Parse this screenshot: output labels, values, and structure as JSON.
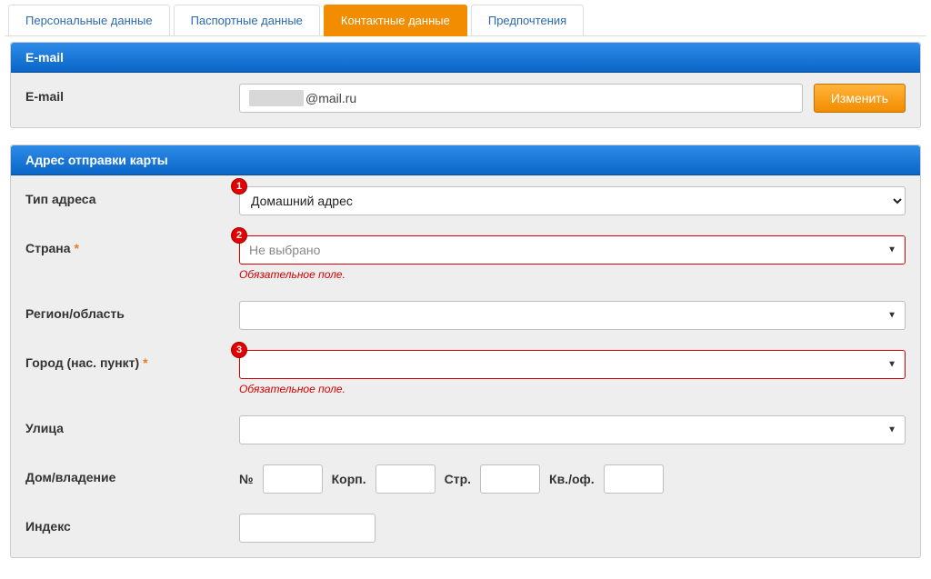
{
  "tabs": [
    {
      "label": "Персональные данные",
      "active": false
    },
    {
      "label": "Паспортные данные",
      "active": false
    },
    {
      "label": "Контактные данные",
      "active": true
    },
    {
      "label": "Предпочтения",
      "active": false
    }
  ],
  "email_section": {
    "header": "E-mail",
    "label": "E-mail",
    "value_suffix": "@mail.ru",
    "button_label": "Изменить"
  },
  "address_section": {
    "header": "Адрес отправки карты",
    "address_type": {
      "label": "Тип адреса",
      "value": "Домашний адрес",
      "badge": "1"
    },
    "country": {
      "label": "Страна",
      "required": true,
      "value": "Не выбрано",
      "error": "Обязательное поле.",
      "badge": "2"
    },
    "region": {
      "label": "Регион/область",
      "value": ""
    },
    "city": {
      "label": "Город (нас. пункт)",
      "required": true,
      "value": "",
      "error": "Обязательное поле.",
      "badge": "3"
    },
    "street": {
      "label": "Улица",
      "value": ""
    },
    "house": {
      "label": "Дом/владение",
      "no_label": "№",
      "korp_label": "Корп.",
      "str_label": "Стр.",
      "kv_label": "Кв./оф."
    },
    "index": {
      "label": "Индекс",
      "value": ""
    }
  }
}
